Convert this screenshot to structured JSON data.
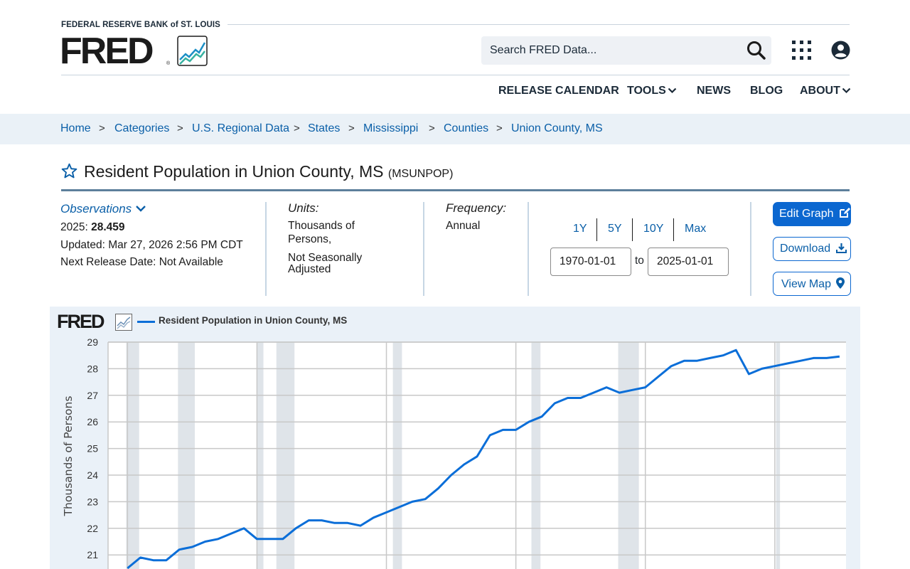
{
  "header": {
    "org_name": "FEDERAL RESERVE BANK of ST. LOUIS",
    "logo_text": "FRED",
    "logo_reg": "®",
    "search_placeholder": "Search FRED Data...",
    "nav": [
      {
        "label": "RELEASE CALENDAR",
        "dropdown": false
      },
      {
        "label": "TOOLS",
        "dropdown": true
      },
      {
        "label": "NEWS",
        "dropdown": false
      },
      {
        "label": "BLOG",
        "dropdown": false
      },
      {
        "label": "ABOUT",
        "dropdown": true
      }
    ]
  },
  "breadcrumb": [
    "Home",
    "Categories",
    "U.S. Regional Data",
    "States",
    "Mississippi",
    "Counties",
    "Union County, MS"
  ],
  "breadcrumb_sep": ">",
  "series": {
    "title": "Resident Population in Union County, MS",
    "code": "(MSUNPOP)"
  },
  "observations": {
    "toggle_label": "Observations",
    "latest_label": "2025:",
    "latest_value": "28.459",
    "updated": "Updated: Mar 27, 2026 2:56 PM CDT",
    "next_release": "Next Release Date: Not Available"
  },
  "units": {
    "label": "Units:",
    "line1": "Thousands of Persons,",
    "line2": "Not Seasonally Adjusted"
  },
  "frequency": {
    "label": "Frequency:",
    "value": "Annual"
  },
  "range": {
    "buttons": [
      "1Y",
      "5Y",
      "10Y",
      "Max"
    ],
    "start": "1970-01-01",
    "to_label": "to",
    "end": "2025-01-01"
  },
  "actions": {
    "edit": "Edit Graph",
    "download": "Download",
    "map": "View Map"
  },
  "colors": {
    "accent": "#0b67d0",
    "series_line": "#0b6ed8",
    "recession_shade": "#dfe4e9",
    "chart_bg": "#eaf1f8"
  },
  "chart_data": {
    "type": "line",
    "logo": "FRED",
    "legend": [
      "Resident Population in Union County, MS"
    ],
    "ylabel": "Thousands of Persons",
    "ylim": [
      20.4,
      29
    ],
    "yticks": [
      21,
      22,
      23,
      24,
      25,
      26,
      27,
      28,
      29
    ],
    "x": [
      1970,
      1971,
      1972,
      1973,
      1974,
      1975,
      1976,
      1977,
      1978,
      1979,
      1980,
      1981,
      1982,
      1983,
      1984,
      1985,
      1986,
      1987,
      1988,
      1989,
      1990,
      1991,
      1992,
      1993,
      1994,
      1995,
      1996,
      1997,
      1998,
      1999,
      2000,
      2001,
      2002,
      2003,
      2004,
      2005,
      2006,
      2007,
      2008,
      2009,
      2010,
      2011,
      2012,
      2013,
      2014,
      2015,
      2016,
      2017,
      2018,
      2019,
      2020,
      2021,
      2022,
      2023,
      2024,
      2025
    ],
    "values": [
      20.5,
      20.9,
      20.8,
      20.8,
      21.2,
      21.3,
      21.5,
      21.6,
      21.8,
      22.0,
      21.6,
      21.6,
      21.6,
      22.0,
      22.3,
      22.3,
      22.2,
      22.2,
      22.1,
      22.4,
      22.6,
      22.8,
      23.0,
      23.1,
      23.5,
      24.0,
      24.4,
      24.7,
      25.5,
      25.7,
      25.7,
      26.0,
      26.2,
      26.7,
      26.9,
      26.9,
      27.1,
      27.3,
      27.1,
      27.2,
      27.3,
      27.7,
      28.1,
      28.3,
      28.3,
      28.4,
      28.5,
      28.7,
      27.8,
      28.0,
      28.1,
      28.2,
      28.3,
      28.4,
      28.4,
      28.459
    ],
    "recession_shading": true,
    "grid": true
  }
}
